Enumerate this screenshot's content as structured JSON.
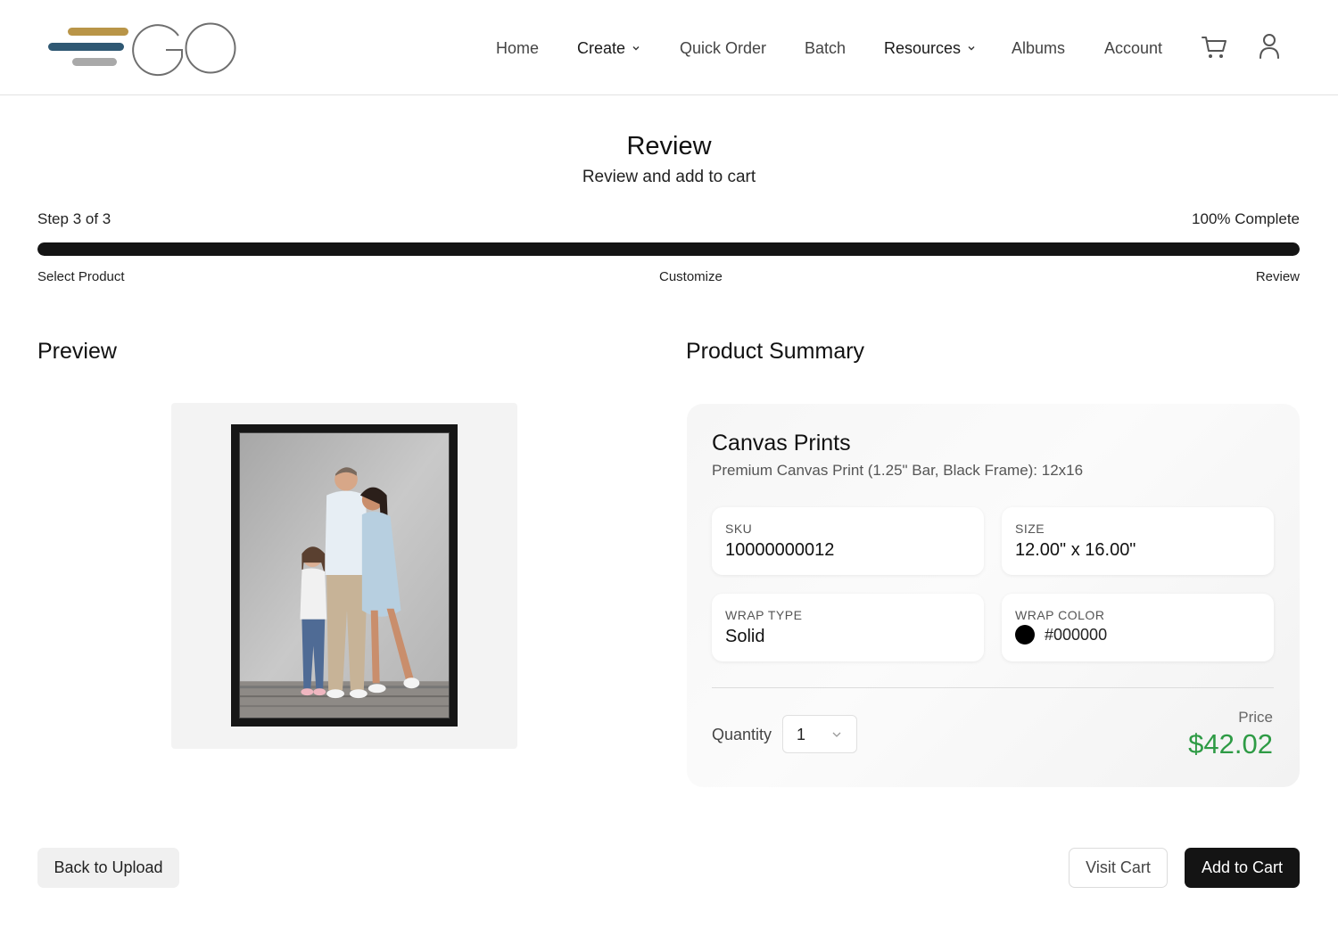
{
  "header": {
    "logo_text": "GO",
    "nav": [
      {
        "label": "Home"
      },
      {
        "label": "Create"
      },
      {
        "label": "Quick Order"
      },
      {
        "label": "Batch"
      },
      {
        "label": "Resources"
      },
      {
        "label": "Albums"
      },
      {
        "label": "Account"
      }
    ],
    "icons": [
      "cart-icon",
      "user-icon"
    ]
  },
  "page": {
    "title": "Review",
    "subtitle": "Review and add to cart"
  },
  "progress": {
    "step_text": "Step 3 of 3",
    "complete_text": "100% Complete",
    "percent": 100,
    "steps": [
      "Select Product",
      "Customize",
      "Review"
    ]
  },
  "preview": {
    "heading": "Preview"
  },
  "summary": {
    "heading": "Product Summary",
    "product_title": "Canvas Prints",
    "product_desc": "Premium Canvas Print (1.25\" Bar, Black Frame): 12x16",
    "attributes": {
      "sku": {
        "label": "SKU",
        "value": "10000000012"
      },
      "size": {
        "label": "Size",
        "value": "12.00\" x 16.00\""
      },
      "wrap_type": {
        "label": "Wrap Type",
        "value": "Solid"
      },
      "wrap_color": {
        "label": "Wrap Color",
        "value": "#000000"
      }
    },
    "quantity_label": "Quantity",
    "quantity_value": "1",
    "price_label": "Price",
    "price_value": "$42.02"
  },
  "actions": {
    "back": "Back to Upload",
    "visit_cart": "Visit Cart",
    "add_to_cart": "Add to Cart"
  },
  "colors": {
    "logo_gold": "#b99548",
    "logo_navy": "#2f5873",
    "logo_gray": "#a9a9a9",
    "price_green": "#2e9b45",
    "progress_fill": "#141414"
  }
}
